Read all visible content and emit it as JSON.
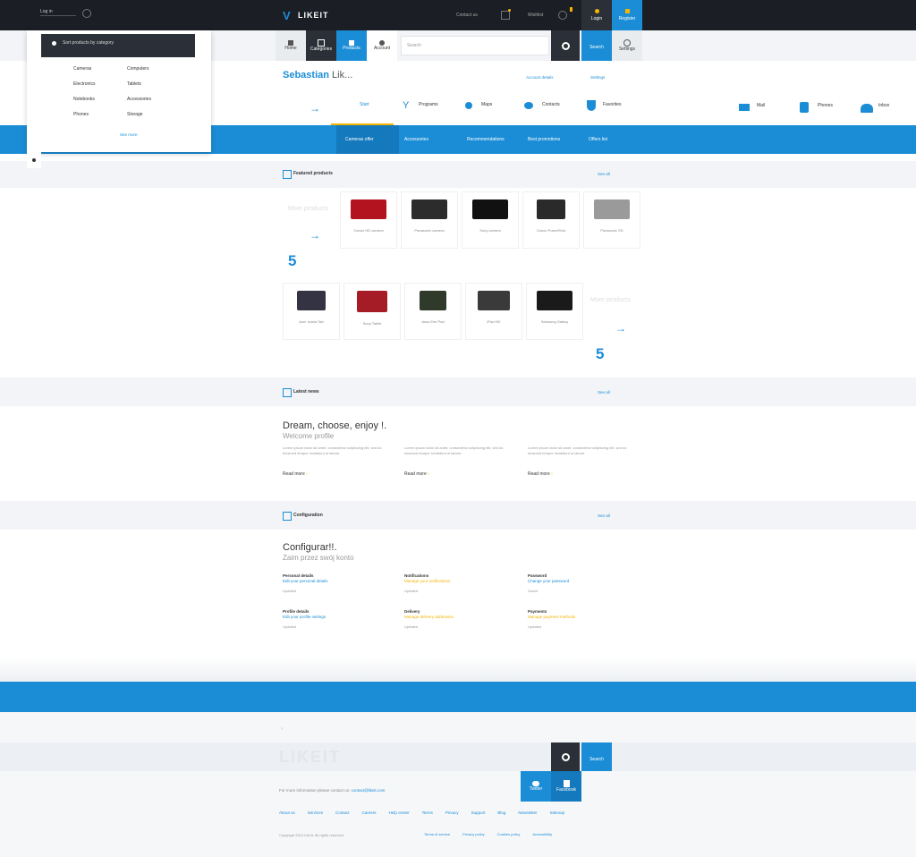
{
  "topbar": {
    "account_label": "Log in",
    "logo_text": "LIKEIT",
    "contact_text": "Contact us",
    "compare_label": "Wishlist",
    "tile1_label": "Login",
    "tile2_label": "Register"
  },
  "dropdown": {
    "header": "Sort products by category",
    "col1": [
      "Cameras",
      "Electronics",
      "Notebooks",
      "Phones"
    ],
    "col2": [
      "Computers",
      "Tablets",
      "Accessories",
      "Storage"
    ],
    "more_link": "See more"
  },
  "subnav": {
    "items": [
      "Home",
      "Categories",
      "Products",
      "Account"
    ],
    "search_placeholder": "Search",
    "tile1_label": "Search",
    "tile2_label": "Settings"
  },
  "profile": {
    "first_name": "Sebastian",
    "last_name": "Lik...",
    "link1": "Account details",
    "link2": "Settings",
    "categories": [
      "Start",
      "Programs",
      "Maps",
      "Contacts",
      "Favorites"
    ],
    "categories_right": [
      "Mail",
      "Phones",
      "Inbox"
    ]
  },
  "bluebar": {
    "items": [
      "Cameras offer",
      "Accessories",
      "Recommendations",
      "Best promotions",
      "Offers list"
    ]
  },
  "section1": {
    "title": "Featured products",
    "right_link": "See all",
    "row1": [
      "Canon HD camera",
      "Panasonic camera",
      "Sony camera",
      "Canon PowerShot",
      "Panasonic SD"
    ],
    "row2": [
      "Acer Iconia Tab",
      "Sony Tablet",
      "Asus Eee Pad",
      "iPad HD",
      "Samsung Galaxy"
    ],
    "counter1": "5",
    "counter2": "5",
    "placeholder_text": "More products"
  },
  "section2": {
    "title": "Latest news",
    "right_link": "See all",
    "heading": "Dream, choose, enjoy !.",
    "subheading": "Welcome profile",
    "read_more": "Read more",
    "col_text": "Lorem ipsum dolor sit amet, consectetur adipiscing elit, sed do eiusmod tempor incididunt ut labore."
  },
  "section3": {
    "title": "Configuration",
    "right_link": "See all",
    "heading": "Configurar!!.",
    "subheading": "Zaim przez swój konto",
    "items": [
      {
        "title": "Personal details",
        "link": "Edit your personal details",
        "meta": "Updated"
      },
      {
        "title": "Notifications",
        "link": "Manage your notifications",
        "meta": "Updated"
      },
      {
        "title": "Password",
        "link": "Change your password",
        "meta": "Saved"
      },
      {
        "title": "Profile details",
        "link": "Edit your profile settings",
        "meta": "Updated"
      },
      {
        "title": "Delivery",
        "link": "Manage delivery addresses",
        "meta": "Updated"
      },
      {
        "title": "Payments",
        "link": "Manage payment methods",
        "meta": "Updated"
      }
    ]
  },
  "footer": {
    "logo_text": "LIKEIT",
    "search_tile": "Search",
    "twitter_label": "Twitter",
    "facebook_label": "Facebook",
    "contact_line": "For more information please contact us:",
    "contact_email": "contact@likeit.com",
    "links": [
      "About us",
      "Services",
      "Contact",
      "Careers",
      "Help center",
      "Terms",
      "Privacy",
      "Support",
      "Blog",
      "Newsletter",
      "Sitemap"
    ],
    "copyright": "Copyright 2013 LikeIt. All rights reserved.",
    "bottom_links": [
      "Terms of service",
      "Privacy policy",
      "Cookies policy",
      "Accessibility"
    ]
  },
  "colors": {
    "accent": "#1b8dd6",
    "dark": "#1b1e24",
    "highlight": "#f5b400"
  }
}
